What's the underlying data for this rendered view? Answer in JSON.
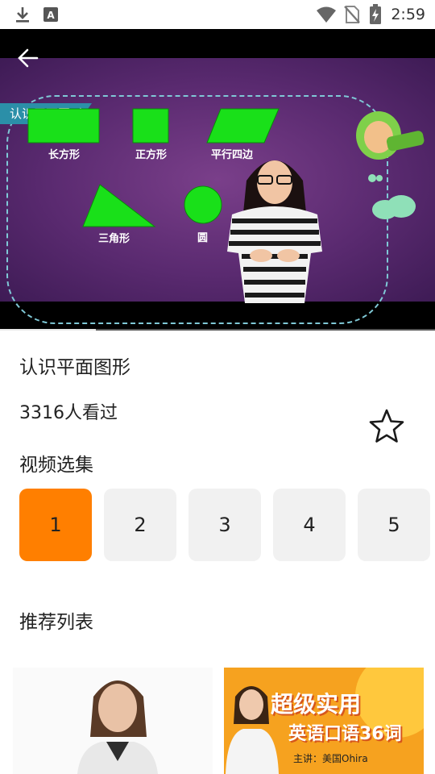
{
  "status_bar": {
    "time": "2:59",
    "icons": [
      "download-icon",
      "app-notification-icon",
      "wifi-icon",
      "no-sim-icon",
      "battery-charging-icon"
    ]
  },
  "video": {
    "lesson_tag": "认识平面图形",
    "shapes": {
      "rectangle": "长方形",
      "square": "正方形",
      "parallelogram": "平行四边",
      "triangle": "三角形",
      "circle": "圆"
    },
    "shape_color": "#19e019",
    "progress_fraction": 0.22
  },
  "details": {
    "title": "认识平面图形",
    "views": "3316人看过",
    "favorite_icon": "star-outline-icon"
  },
  "episodes": {
    "section_title": "视频选集",
    "items": [
      "1",
      "2",
      "3",
      "4",
      "5"
    ],
    "selected": "1",
    "accent_color": "#ff7f00"
  },
  "recommend": {
    "section_title": "推荐列表",
    "cards": [
      {
        "image": "woman-portrait-thumbnail"
      },
      {
        "line1": "超级实用",
        "line2": "英语口语36词",
        "byline": "主讲：美国Ohira"
      }
    ]
  }
}
